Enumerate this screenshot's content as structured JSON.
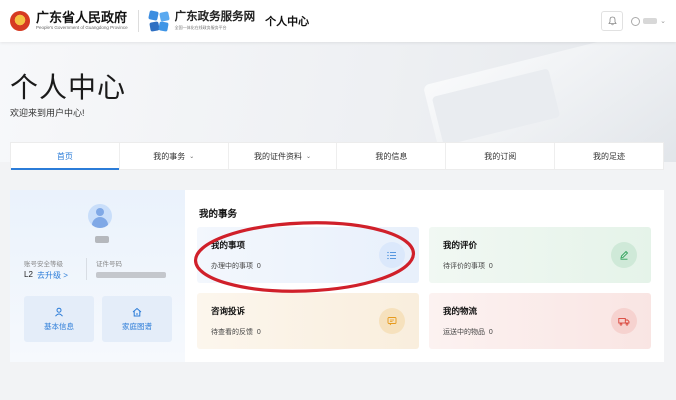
{
  "header": {
    "brand": "广东省人民政府",
    "brand_en": "People's Government of Guangdong Province",
    "gov_service": "广东政务服务网",
    "gov_service_sub": "全国一体化在线政务服务平台",
    "crumb": "个人中心",
    "icons": [
      "emblem-icon",
      "gov-service-logo-icon",
      "bell-icon",
      "user-icon",
      "chevron-down-icon"
    ]
  },
  "hero": {
    "title": "个人中心",
    "subtitle": "欢迎来到用户中心!"
  },
  "nav": {
    "tabs": [
      {
        "label": "首页",
        "dropdown": false,
        "active": true
      },
      {
        "label": "我的事务",
        "dropdown": true
      },
      {
        "label": "我的证件资料",
        "dropdown": true
      },
      {
        "label": "我的信息",
        "dropdown": false
      },
      {
        "label": "我的订阅",
        "dropdown": false
      },
      {
        "label": "我的足迹",
        "dropdown": false
      }
    ],
    "caret": "⌄"
  },
  "profile": {
    "security_label": "账号安全等级",
    "security_level": "L2",
    "upgrade": "去升级 >",
    "id_label": "证件号码",
    "buttons": [
      {
        "label": "基本信息",
        "icon": "person-icon"
      },
      {
        "label": "家庭图谱",
        "icon": "home-icon"
      }
    ]
  },
  "affairs": {
    "title": "我的事务",
    "cards": [
      {
        "title": "我的事项",
        "sub": "办理中的事项",
        "count": "0",
        "icon": "list-icon",
        "color": "#2b7cd8"
      },
      {
        "title": "我的评价",
        "sub": "待评价的事项",
        "count": "0",
        "icon": "edit-icon",
        "color": "#2fa25a"
      },
      {
        "title": "咨询投诉",
        "sub": "待查看的反馈",
        "count": "0",
        "icon": "message-icon",
        "color": "#e69a1c"
      },
      {
        "title": "我的物流",
        "sub": "运送中的物品",
        "count": "0",
        "icon": "truck-icon",
        "color": "#d9443a"
      }
    ]
  },
  "colors": {
    "accent": "#2b7cd8",
    "annotation": "#d0202a"
  }
}
